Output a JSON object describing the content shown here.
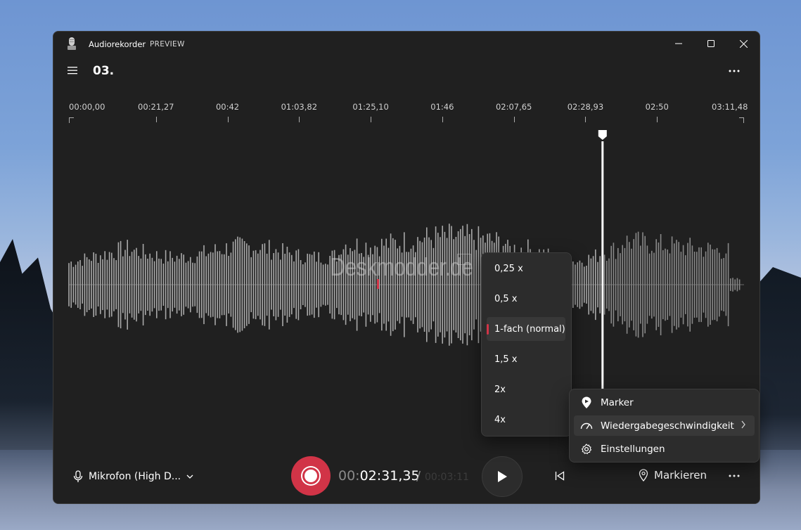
{
  "window": {
    "app_title": "Audiorekorder",
    "app_badge": "PREVIEW",
    "controls": [
      "minimize-icon",
      "maximize-icon",
      "close-icon"
    ]
  },
  "header": {
    "recording_title": "03."
  },
  "timeline": {
    "ticks": [
      "00:00,00",
      "00:21,27",
      "00:42",
      "01:03,82",
      "01:25,10",
      "01:46",
      "02:07,65",
      "02:28,93",
      "02:50",
      "03:11,48"
    ]
  },
  "waveform": {
    "watermark": "Deskmodder.de",
    "watermark_badge": "",
    "playhead_seconds": 151.35,
    "duration_seconds": 191.48
  },
  "bottom_bar": {
    "microphone": "Mikrofon (High D...",
    "time_hours_dim": "00:",
    "time_current": "02:31,35",
    "time_separator": "/",
    "time_total": "00:03:11",
    "mark_label": "Markieren"
  },
  "context_menu": {
    "items": [
      {
        "label": "Marker",
        "icon": "marker-icon"
      },
      {
        "label": "Wiedergabegeschwindigkeit",
        "icon": "speed-icon"
      },
      {
        "label": "Einstellungen",
        "icon": "gear-icon"
      }
    ]
  },
  "speed_submenu": {
    "options": [
      "0,25 x",
      "0,5 x",
      "1-fach (normal)",
      "1,5 x",
      "2x",
      "4x"
    ],
    "selected": "1-fach (normal)"
  },
  "colors": {
    "accent": "#d13447",
    "background": "#202020",
    "menu": "#2c2c2c"
  }
}
